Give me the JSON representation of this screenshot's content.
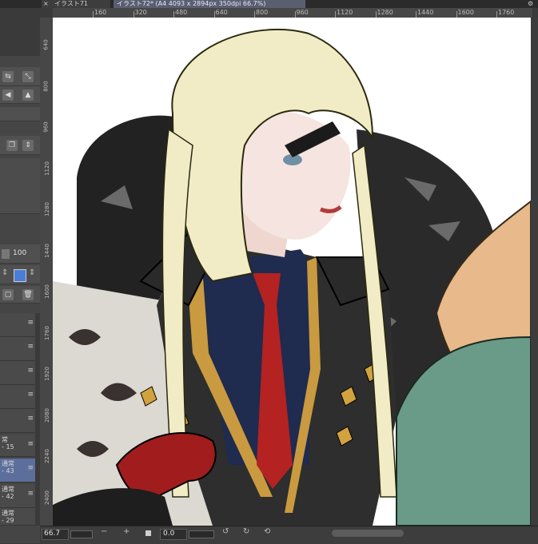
{
  "tabs": [
    {
      "label": "イラスト71"
    },
    {
      "label": "イラスト72* (A4 4093 x 2894px 350dpi 66.7%)"
    }
  ],
  "ruler_top": [
    "160",
    "320",
    "480",
    "640",
    "800",
    "960",
    "1120",
    "1280",
    "1440",
    "1600",
    "1760"
  ],
  "ruler_left": [
    "640",
    "800",
    "960",
    "1120",
    "1280",
    "1440",
    "1600",
    "1760",
    "1920",
    "2080",
    "2240",
    "2400"
  ],
  "left_panel": {
    "opacity_value": "100",
    "layers": [
      {
        "mode": "常",
        "value": "15"
      },
      {
        "mode": "通常",
        "value": "43"
      },
      {
        "mode": "通常",
        "value": "42"
      },
      {
        "mode": "通常",
        "value": "29"
      }
    ]
  },
  "bottom": {
    "zoom": "66.7",
    "rotation": "0.0"
  },
  "icons": {
    "close": "close-icon",
    "zoom_out": "minus-icon",
    "zoom_in": "plus-icon",
    "rotate_left": "rotate-left-icon",
    "rotate_right": "rotate-right-icon",
    "reset": "reset-icon"
  }
}
